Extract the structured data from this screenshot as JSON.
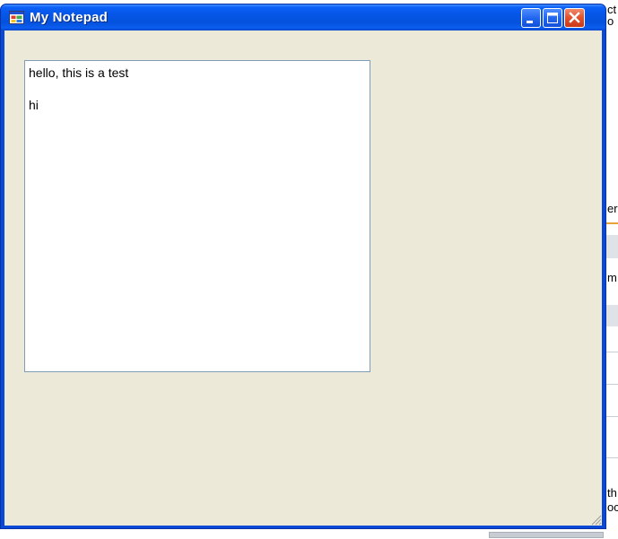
{
  "window": {
    "title": "My Notepad",
    "icon": "app-window-icon",
    "buttons": {
      "minimize": "minimize-icon",
      "maximize": "maximize-icon",
      "close": "close-icon"
    }
  },
  "editor": {
    "lines": [
      "hello, this is a test",
      "",
      "hi"
    ]
  },
  "background_app": {
    "fragments": [
      "ct",
      "o",
      "er",
      "m",
      "th",
      "oc"
    ]
  },
  "colors": {
    "titlebar": "#0a5ff5",
    "client": "#ece9d8",
    "close_button": "#e2502b"
  }
}
